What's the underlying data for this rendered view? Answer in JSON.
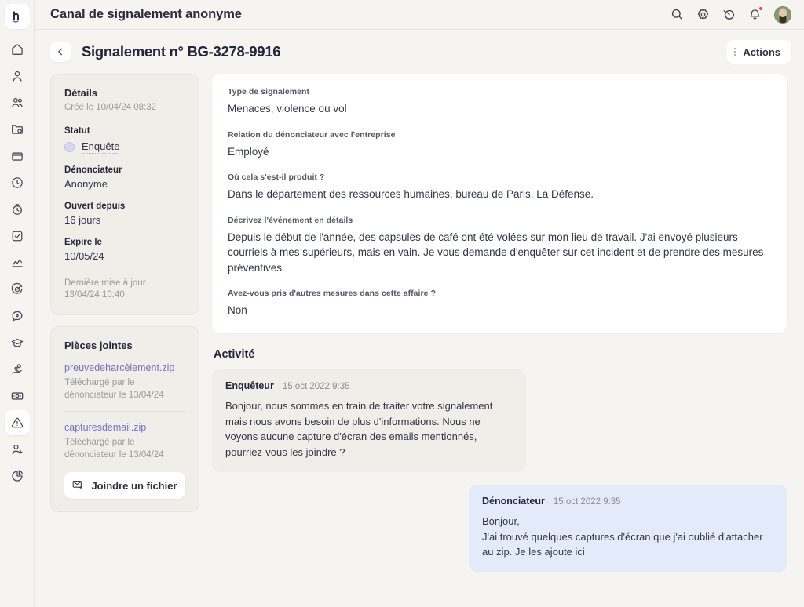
{
  "brand": {
    "logo_letter": "h",
    "accent": "#4B7BE8"
  },
  "topbar": {
    "title": "Canal de signalement anonyme",
    "icons": [
      {
        "name": "search-icon",
        "label": "Rechercher"
      },
      {
        "name": "gear-icon",
        "label": "Paramètres"
      },
      {
        "name": "timer-icon",
        "label": "Suivi du temps"
      },
      {
        "name": "bell-icon",
        "label": "Notifications",
        "badge": true
      }
    ],
    "avatar_label": "Profil"
  },
  "rail": {
    "items": [
      {
        "name": "home-icon",
        "label": "Accueil",
        "active": false
      },
      {
        "name": "user-icon",
        "label": "Mon profil",
        "active": false
      },
      {
        "name": "users-icon",
        "label": "Employés",
        "active": false
      },
      {
        "name": "folder-icon",
        "label": "Documents",
        "active": false
      },
      {
        "name": "briefcase-icon",
        "label": "Recrutement",
        "active": false
      },
      {
        "name": "clock-icon",
        "label": "Absences",
        "active": false
      },
      {
        "name": "stopwatch-icon",
        "label": "Temps de travail",
        "active": false
      },
      {
        "name": "checkbox-icon",
        "label": "Tâches",
        "active": false
      },
      {
        "name": "chart-line-icon",
        "label": "Rapports",
        "active": false
      },
      {
        "name": "target-icon",
        "label": "Objectifs",
        "active": false
      },
      {
        "name": "chat-icon",
        "label": "Messages",
        "active": false
      },
      {
        "name": "graduation-cap-icon",
        "label": "Formation",
        "active": false
      },
      {
        "name": "hand-coins-icon",
        "label": "Avantages",
        "active": false
      },
      {
        "name": "money-icon",
        "label": "Paie",
        "active": false
      },
      {
        "name": "alert-triangle-icon",
        "label": "Signalements",
        "active": true
      },
      {
        "name": "user-plus-icon",
        "label": "Intégration",
        "active": false
      },
      {
        "name": "pie-chart-icon",
        "label": "Analyses",
        "active": false
      }
    ]
  },
  "page": {
    "back_label": "Retour",
    "title": "Signalement n° BG-3278-9916",
    "actions_label": "Actions"
  },
  "details": {
    "title": "Détails",
    "created": "Créé le 10/04/24 08:32",
    "fields": [
      {
        "label": "Statut",
        "value": "Enquête",
        "type": "status",
        "dot_color": "#D8D6F2"
      },
      {
        "label": "Dénonciateur",
        "value": "Anonyme",
        "type": "text"
      },
      {
        "label": "Ouvert depuis",
        "value": "16 jours",
        "type": "text"
      },
      {
        "label": "Expire le",
        "value": "10/05/24",
        "type": "text"
      }
    ],
    "last_update_label": "Dernière mise à jour",
    "last_update_value": "13/04/24 10:40"
  },
  "attachments": {
    "title": "Pièces jointes",
    "items": [
      {
        "filename": "preuvedeharcèlement.zip",
        "meta": "Téléchargé par le dénonciateur le 13/04/24"
      },
      {
        "filename": "capturesdemail.zip",
        "meta": "Téléchargé par le dénonciateur le 13/04/24"
      }
    ],
    "button_label": "Joindre un fichier",
    "link_color": "#7573C6"
  },
  "report": {
    "blocks": [
      {
        "label": "Type de signalement",
        "value": "Menaces, violence ou vol"
      },
      {
        "label": "Relation du dénonciateur avec l'entreprise",
        "value": "Employé"
      },
      {
        "label": "Où cela s'est-il produit ?",
        "value": "Dans le département des ressources humaines, bureau de Paris, La Défense."
      },
      {
        "label": "Décrivez l'événement en détails",
        "value": "Depuis le début de l'année, des capsules de café ont été volées sur mon lieu de travail. J'ai envoyé plusieurs courriels à mes supérieurs, mais en vain. Je vous demande d'enquêter sur cet incident et de prendre des mesures préventives."
      },
      {
        "label": "Avez-vous pris d'autres mesures dans cette affaire ?",
        "value": "Non"
      }
    ]
  },
  "activity": {
    "title": "Activité",
    "messages": [
      {
        "author": "Enquêteur",
        "time": "15 oct 2022 9:35",
        "text": "Bonjour, nous sommes en train de traiter votre signalement mais nous avons besoin de plus d'informations. Nous ne voyons aucune capture d'écran des emails mentionnés, pourriez-vous les joindre ?",
        "side": "left"
      },
      {
        "author": "Dénonciateur",
        "time": "15 oct 2022 9:35",
        "text": "Bonjour,\nJ'ai trouvé quelques captures d'écran que j'ai oublié d'attacher au zip. Je les ajoute ici",
        "side": "right"
      }
    ]
  }
}
